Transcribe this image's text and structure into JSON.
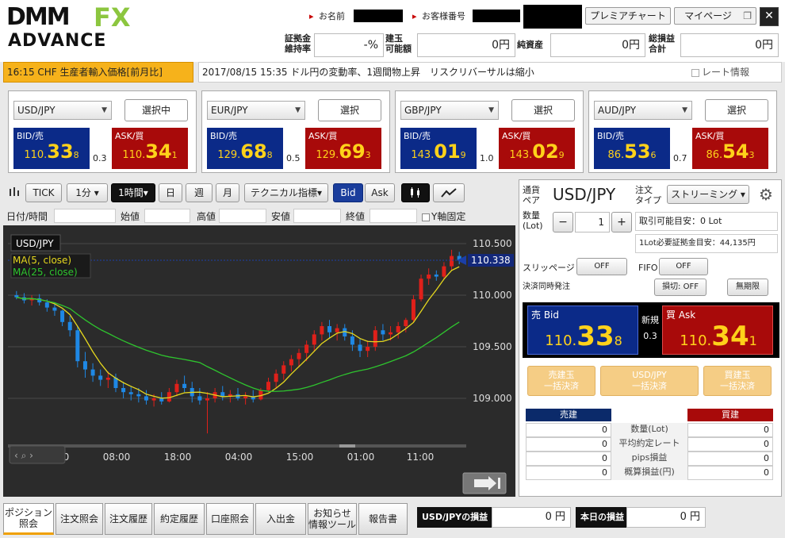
{
  "header": {
    "logo_dmm": "DMM",
    "logo_fx": "FX",
    "logo_advance": "ADVANCE",
    "name_label": "お名前",
    "customer_label": "お客様番号",
    "premier_button": "プレミアチャート",
    "mypage_button": "マイページ",
    "close_symbol": "✕",
    "margin_ratio_label": "証拠金\n維持率",
    "margin_ratio_value": "-%",
    "open_pos_label": "建玉\n可能額",
    "open_pos_value": "0円",
    "net_assets_label": "純資産",
    "net_assets_value": "0円",
    "total_pl_label": "総損益\n合計",
    "total_pl_value": "0円"
  },
  "ticker": {
    "left": "16:15  CHF  生産者輸入価格[前月比]",
    "right": "2017/08/15 15:35 ドル円の変動率、1週間物上昇　リスクリバーサルは縮小",
    "rate_info_label": "レート情報"
  },
  "pairs": [
    {
      "pair": "USD/JPY",
      "button": "選択中",
      "bid_label": "BID/売",
      "ask_label": "ASK/買",
      "bid": [
        "110.",
        "33",
        "8"
      ],
      "ask": [
        "110.",
        "34",
        "1"
      ],
      "spread": "0.3"
    },
    {
      "pair": "EUR/JPY",
      "button": "選択",
      "bid_label": "BID/売",
      "ask_label": "ASK/買",
      "bid": [
        "129.",
        "68",
        "8"
      ],
      "ask": [
        "129.",
        "69",
        "3"
      ],
      "spread": "0.5"
    },
    {
      "pair": "GBP/JPY",
      "button": "選択",
      "bid_label": "BID/売",
      "ask_label": "ASK/買",
      "bid": [
        "143.",
        "01",
        "9"
      ],
      "ask": [
        "143.",
        "02",
        "9"
      ],
      "spread": "1.0"
    },
    {
      "pair": "AUD/JPY",
      "button": "選択",
      "bid_label": "BID/売",
      "ask_label": "ASK/買",
      "bid": [
        "86.",
        "53",
        "6"
      ],
      "ask": [
        "86.",
        "54",
        "3"
      ],
      "spread": "0.7"
    }
  ],
  "chart_toolbar": {
    "tick": "TICK",
    "min1": "1分 ▾",
    "hour1": "1時間▾",
    "day": "日",
    "week": "週",
    "month": "月",
    "technical": "テクニカル指標▾",
    "bid": "Bid",
    "ask": "Ask"
  },
  "ohlc": {
    "datetime": "日付/時間",
    "open": "始値",
    "high": "高値",
    "low": "安値",
    "close": "終値",
    "yaxis_fixed": "Y軸固定"
  },
  "chart": {
    "symbol": "USD/JPY",
    "ma5": "MA(5, close)",
    "ma25": "MA(25, close)",
    "current": "110.338",
    "y_ticks": [
      "110.500",
      "110.000",
      "109.500",
      "109.000"
    ],
    "x_ticks": [
      "22:00",
      "08:00",
      "18:00",
      "04:00",
      "15:00",
      "01:00",
      "11:00"
    ],
    "colors": {
      "up": "#e0201a",
      "down": "#1e88e5",
      "ma5": "#e6d81e",
      "ma25": "#2ec42e"
    }
  },
  "chart_data": {
    "type": "candlestick",
    "ylim": [
      108.6,
      110.6
    ],
    "candles": [
      [
        110.0,
        110.04,
        109.96,
        109.98
      ],
      [
        109.98,
        110.02,
        109.92,
        109.95
      ],
      [
        109.95,
        110.0,
        109.9,
        109.97
      ],
      [
        109.97,
        110.01,
        109.9,
        109.93
      ],
      [
        109.93,
        109.96,
        109.84,
        109.88
      ],
      [
        109.88,
        109.92,
        109.8,
        109.85
      ],
      [
        109.85,
        109.86,
        109.7,
        109.74
      ],
      [
        109.74,
        109.8,
        109.6,
        109.66
      ],
      [
        109.66,
        109.7,
        109.3,
        109.36
      ],
      [
        109.36,
        109.45,
        109.2,
        109.28
      ],
      [
        109.28,
        109.34,
        109.16,
        109.22
      ],
      [
        109.22,
        109.28,
        109.12,
        109.18
      ],
      [
        109.18,
        109.26,
        109.1,
        109.2
      ],
      [
        109.2,
        109.24,
        109.06,
        109.1
      ],
      [
        109.1,
        109.16,
        109.0,
        109.06
      ],
      [
        109.06,
        109.12,
        108.98,
        109.04
      ],
      [
        109.04,
        109.1,
        108.96,
        109.02
      ],
      [
        109.02,
        109.08,
        108.94,
        108.98
      ],
      [
        108.98,
        109.04,
        108.92,
        109.0
      ],
      [
        109.0,
        109.06,
        108.94,
        108.97
      ],
      [
        108.97,
        109.1,
        108.96,
        109.06
      ],
      [
        109.06,
        109.18,
        109.02,
        109.14
      ],
      [
        109.14,
        109.22,
        109.06,
        109.1
      ],
      [
        109.1,
        109.16,
        108.96,
        109.02
      ],
      [
        109.02,
        109.1,
        108.94,
        108.98
      ],
      [
        108.98,
        109.06,
        108.66,
        109.0
      ],
      [
        109.0,
        109.1,
        108.96,
        109.06
      ],
      [
        109.06,
        109.12,
        108.98,
        109.02
      ],
      [
        109.02,
        109.08,
        108.96,
        109.04
      ],
      [
        109.04,
        109.1,
        108.98,
        109.0
      ],
      [
        109.0,
        109.06,
        108.94,
        109.02
      ],
      [
        109.02,
        109.08,
        108.96,
        108.99
      ],
      [
        108.99,
        109.1,
        108.98,
        109.08
      ],
      [
        109.08,
        109.2,
        109.06,
        109.16
      ],
      [
        109.16,
        109.28,
        109.1,
        109.24
      ],
      [
        109.24,
        109.36,
        109.18,
        109.32
      ],
      [
        109.32,
        109.42,
        109.26,
        109.38
      ],
      [
        109.38,
        109.48,
        109.3,
        109.44
      ],
      [
        109.44,
        109.56,
        109.36,
        109.52
      ],
      [
        109.52,
        109.66,
        109.46,
        109.62
      ],
      [
        109.62,
        109.74,
        109.56,
        109.7
      ],
      [
        109.7,
        109.76,
        109.58,
        109.64
      ],
      [
        109.64,
        109.72,
        109.56,
        109.68
      ],
      [
        109.68,
        109.72,
        109.56,
        109.6
      ],
      [
        109.6,
        109.66,
        109.46,
        109.52
      ],
      [
        109.52,
        109.58,
        109.4,
        109.46
      ],
      [
        109.46,
        109.56,
        109.4,
        109.5
      ],
      [
        109.5,
        109.7,
        109.46,
        109.66
      ],
      [
        109.66,
        109.72,
        109.56,
        109.62
      ],
      [
        109.62,
        109.7,
        109.56,
        109.64
      ],
      [
        109.64,
        109.74,
        109.58,
        109.7
      ],
      [
        109.7,
        109.78,
        109.64,
        109.76
      ],
      [
        109.76,
        110.0,
        109.74,
        109.96
      ],
      [
        109.96,
        110.2,
        109.94,
        110.16
      ],
      [
        110.16,
        110.26,
        110.1,
        110.2
      ],
      [
        110.2,
        110.24,
        110.14,
        110.18
      ],
      [
        110.18,
        110.32,
        110.16,
        110.28
      ],
      [
        110.28,
        110.44,
        110.24,
        110.38
      ],
      [
        110.38,
        110.42,
        110.3,
        110.34
      ]
    ],
    "ylabel": "",
    "xlabel": ""
  },
  "order": {
    "pair_label": "通貨\nペア",
    "pair": "USD/JPY",
    "type_label": "注文\nタイプ",
    "type": "ストリーミング",
    "qty_label": "数量\n(Lot)",
    "qty": "1",
    "minus": "−",
    "plus": "+",
    "tradable": "取引可能目安：0 Lot",
    "margin_need": "1Lot必要証拠金目安：44,135円",
    "slippage": "スリッページ",
    "slippage_val": "OFF",
    "fifo": "FIFO",
    "fifo_val": "OFF",
    "settle_label": "決済同時発注",
    "stop_loss": "損切: OFF",
    "unlimited": "無期限",
    "sell_bid": "売 Bid",
    "buy_ask": "買 Ask",
    "new_label": "新規",
    "spread": "0.3",
    "sell_price": [
      "110.",
      "33",
      "8"
    ],
    "buy_price": [
      "110.",
      "34",
      "1"
    ],
    "sell_close": "売建玉\n一括決済",
    "pair_close": "USD/JPY\n一括決済",
    "buy_close": "買建玉\n一括決済",
    "sell_header": "売建",
    "buy_header": "買建",
    "rows": [
      {
        "label": "数量(Lot)",
        "sell": "0",
        "buy": "0"
      },
      {
        "label": "平均約定レート",
        "sell": "0",
        "buy": "0"
      },
      {
        "label": "pips損益",
        "sell": "0",
        "buy": "0"
      },
      {
        "label": "概算損益(円)",
        "sell": "0",
        "buy": "0"
      }
    ]
  },
  "bottom": {
    "tabs": [
      "ポジション\n照会",
      "注文照会",
      "注文履歴",
      "約定履歴",
      "口座照会",
      "入出金",
      "お知らせ\n情報ツール",
      "報告書"
    ],
    "pair_pl_label": "USD/JPYの損益",
    "pair_pl_value": "0 円",
    "today_pl_label": "本日の損益",
    "today_pl_value": "0 円"
  }
}
